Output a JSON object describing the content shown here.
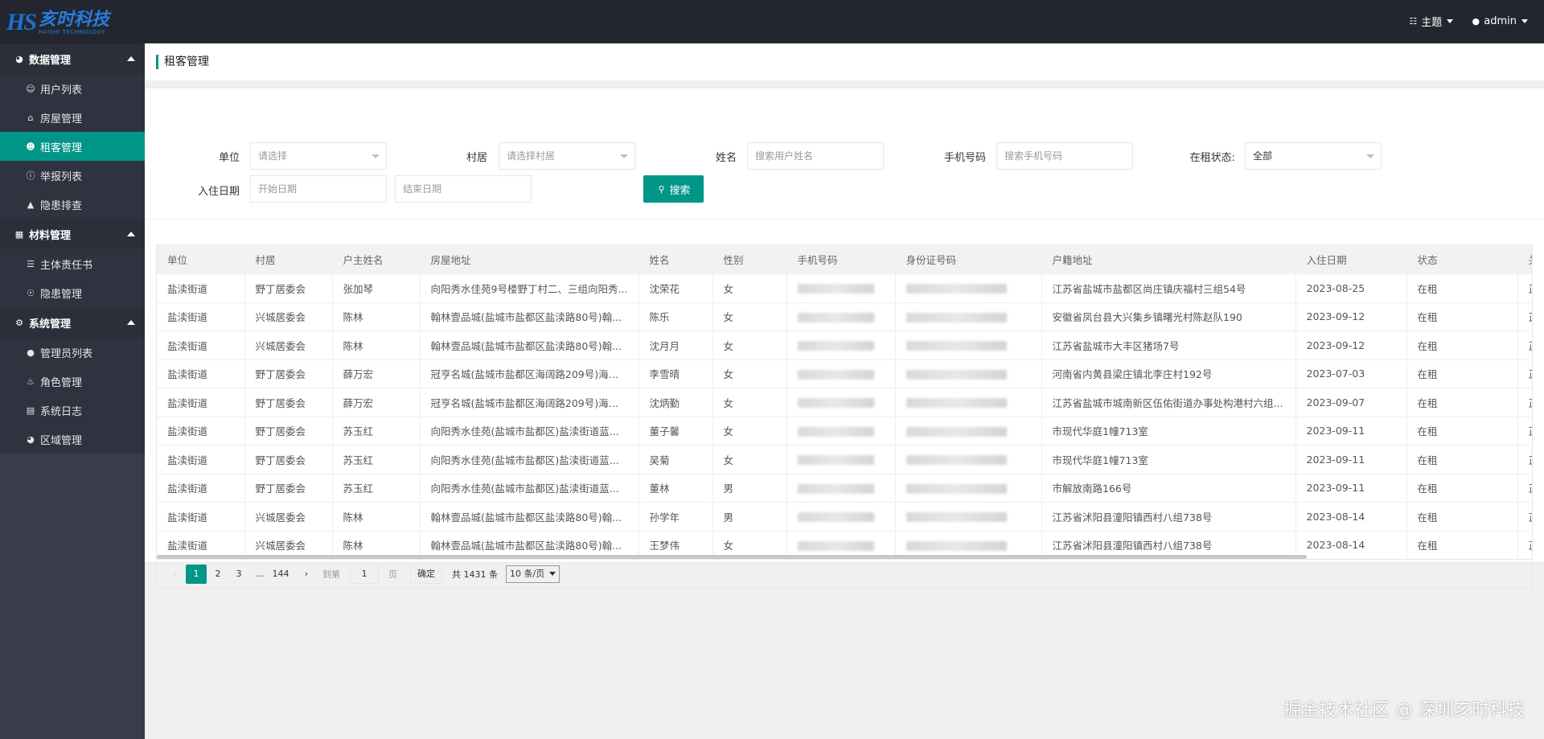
{
  "brand": {
    "logo_mark": "HS",
    "name_cn": "亥时科技",
    "name_en": "HAISHI TECHNOLOGY"
  },
  "topbar": {
    "theme_label": "主题",
    "user_label": "admin"
  },
  "sidebar": {
    "groups": [
      {
        "title": "数据管理",
        "items": [
          "用户列表",
          "房屋管理",
          "租客管理",
          "举报列表",
          "隐患排查"
        ]
      },
      {
        "title": "材料管理",
        "items": [
          "主体责任书",
          "隐患管理"
        ]
      },
      {
        "title": "系统管理",
        "items": [
          "管理员列表",
          "角色管理",
          "系统日志",
          "区域管理"
        ]
      }
    ],
    "active_item": "租客管理"
  },
  "page": {
    "title": "租客管理"
  },
  "filters": {
    "unit_label": "单位",
    "unit_placeholder": "请选择",
    "village_label": "村居",
    "village_placeholder": "请选择村居",
    "name_label": "姓名",
    "name_placeholder": "搜索用户姓名",
    "phone_label": "手机号码",
    "phone_placeholder": "搜索手机号码",
    "status_label": "在租状态:",
    "status_value": "全部",
    "date_label": "入住日期",
    "start_placeholder": "开始日期",
    "end_placeholder": "结束日期",
    "search_label": "搜索"
  },
  "table": {
    "columns": [
      "单位",
      "村居",
      "户主姓名",
      "房屋地址",
      "姓名",
      "性别",
      "手机号码",
      "身份证号码",
      "户籍地址",
      "入住日期",
      "状态",
      "关"
    ],
    "rows": [
      [
        "盐渎街道",
        "野丁居委会",
        "张加琴",
        "向阳秀水佳苑9号楼野丁村二、三组向阳秀...",
        "沈荣花",
        "女",
        "",
        "",
        "江苏省盐城市盐都区尚庄镇庆福村三组54号",
        "2023-08-25",
        "在租",
        "正"
      ],
      [
        "盐渎街道",
        "兴城居委会",
        "陈林",
        "翰林壹品城(盐城市盐都区盐渎路80号)翰...",
        "陈乐",
        "女",
        "",
        "",
        "安徽省凤台县大兴集乡镇曙光村陈赵队190",
        "2023-09-12",
        "在租",
        "正"
      ],
      [
        "盐渎街道",
        "兴城居委会",
        "陈林",
        "翰林壹品城(盐城市盐都区盐渎路80号)翰...",
        "沈月月",
        "女",
        "",
        "",
        "江苏省盐城市大丰区猪场7号",
        "2023-09-12",
        "在租",
        "正"
      ],
      [
        "盐渎街道",
        "野丁居委会",
        "薛万宏",
        "冠亨名城(盐城市盐都区海阔路209号)海阔...",
        "李雪晴",
        "女",
        "",
        "",
        "河南省内黄县梁庄镇北李庄村192号",
        "2023-07-03",
        "在租",
        "正"
      ],
      [
        "盐渎街道",
        "野丁居委会",
        "薛万宏",
        "冠亨名城(盐城市盐都区海阔路209号)海阔...",
        "沈炳勤",
        "女",
        "",
        "",
        "江苏省盐城市城南新区伍佑街道办事处构港村六组...",
        "2023-09-07",
        "在租",
        "正"
      ],
      [
        "盐渎街道",
        "野丁居委会",
        "苏玉红",
        "向阳秀水佳苑(盐城市盐都区)盐渎街道蓝...",
        "董子馨",
        "女",
        "",
        "",
        "市现代华庭1幢713室",
        "2023-09-11",
        "在租",
        "正"
      ],
      [
        "盐渎街道",
        "野丁居委会",
        "苏玉红",
        "向阳秀水佳苑(盐城市盐都区)盐渎街道蓝...",
        "吴菊",
        "女",
        "",
        "",
        "市现代华庭1幢713室",
        "2023-09-11",
        "在租",
        "正"
      ],
      [
        "盐渎街道",
        "野丁居委会",
        "苏玉红",
        "向阳秀水佳苑(盐城市盐都区)盐渎街道蓝...",
        "董林",
        "男",
        "",
        "",
        "市解放南路166号",
        "2023-09-11",
        "在租",
        "正"
      ],
      [
        "盐渎街道",
        "兴城居委会",
        "陈林",
        "翰林壹品城(盐城市盐都区盐渎路80号)翰...",
        "孙学年",
        "男",
        "",
        "",
        "江苏省沭阳县潼阳镇西村八组738号",
        "2023-08-14",
        "在租",
        "正"
      ],
      [
        "盐渎街道",
        "兴城居委会",
        "陈林",
        "翰林壹品城(盐城市盐都区盐渎路80号)翰...",
        "王梦伟",
        "女",
        "",
        "",
        "江苏省沭阳县潼阳镇西村八组738号",
        "2023-08-14",
        "在租",
        "正"
      ]
    ]
  },
  "pagination": {
    "pages": [
      "1",
      "2",
      "3"
    ],
    "ellipsis": "...",
    "last_page": "144",
    "goto_label": "到第",
    "goto_value": "1",
    "page_unit": "页",
    "confirm_label": "确定",
    "total_label": "共 1431 条",
    "page_size": "10 条/页"
  },
  "watermark": "掘金技术社区 @ 深圳亥时科技",
  "colors": {
    "accent": "#009688",
    "topbar": "#23262e",
    "sidebar": "#393d49"
  }
}
